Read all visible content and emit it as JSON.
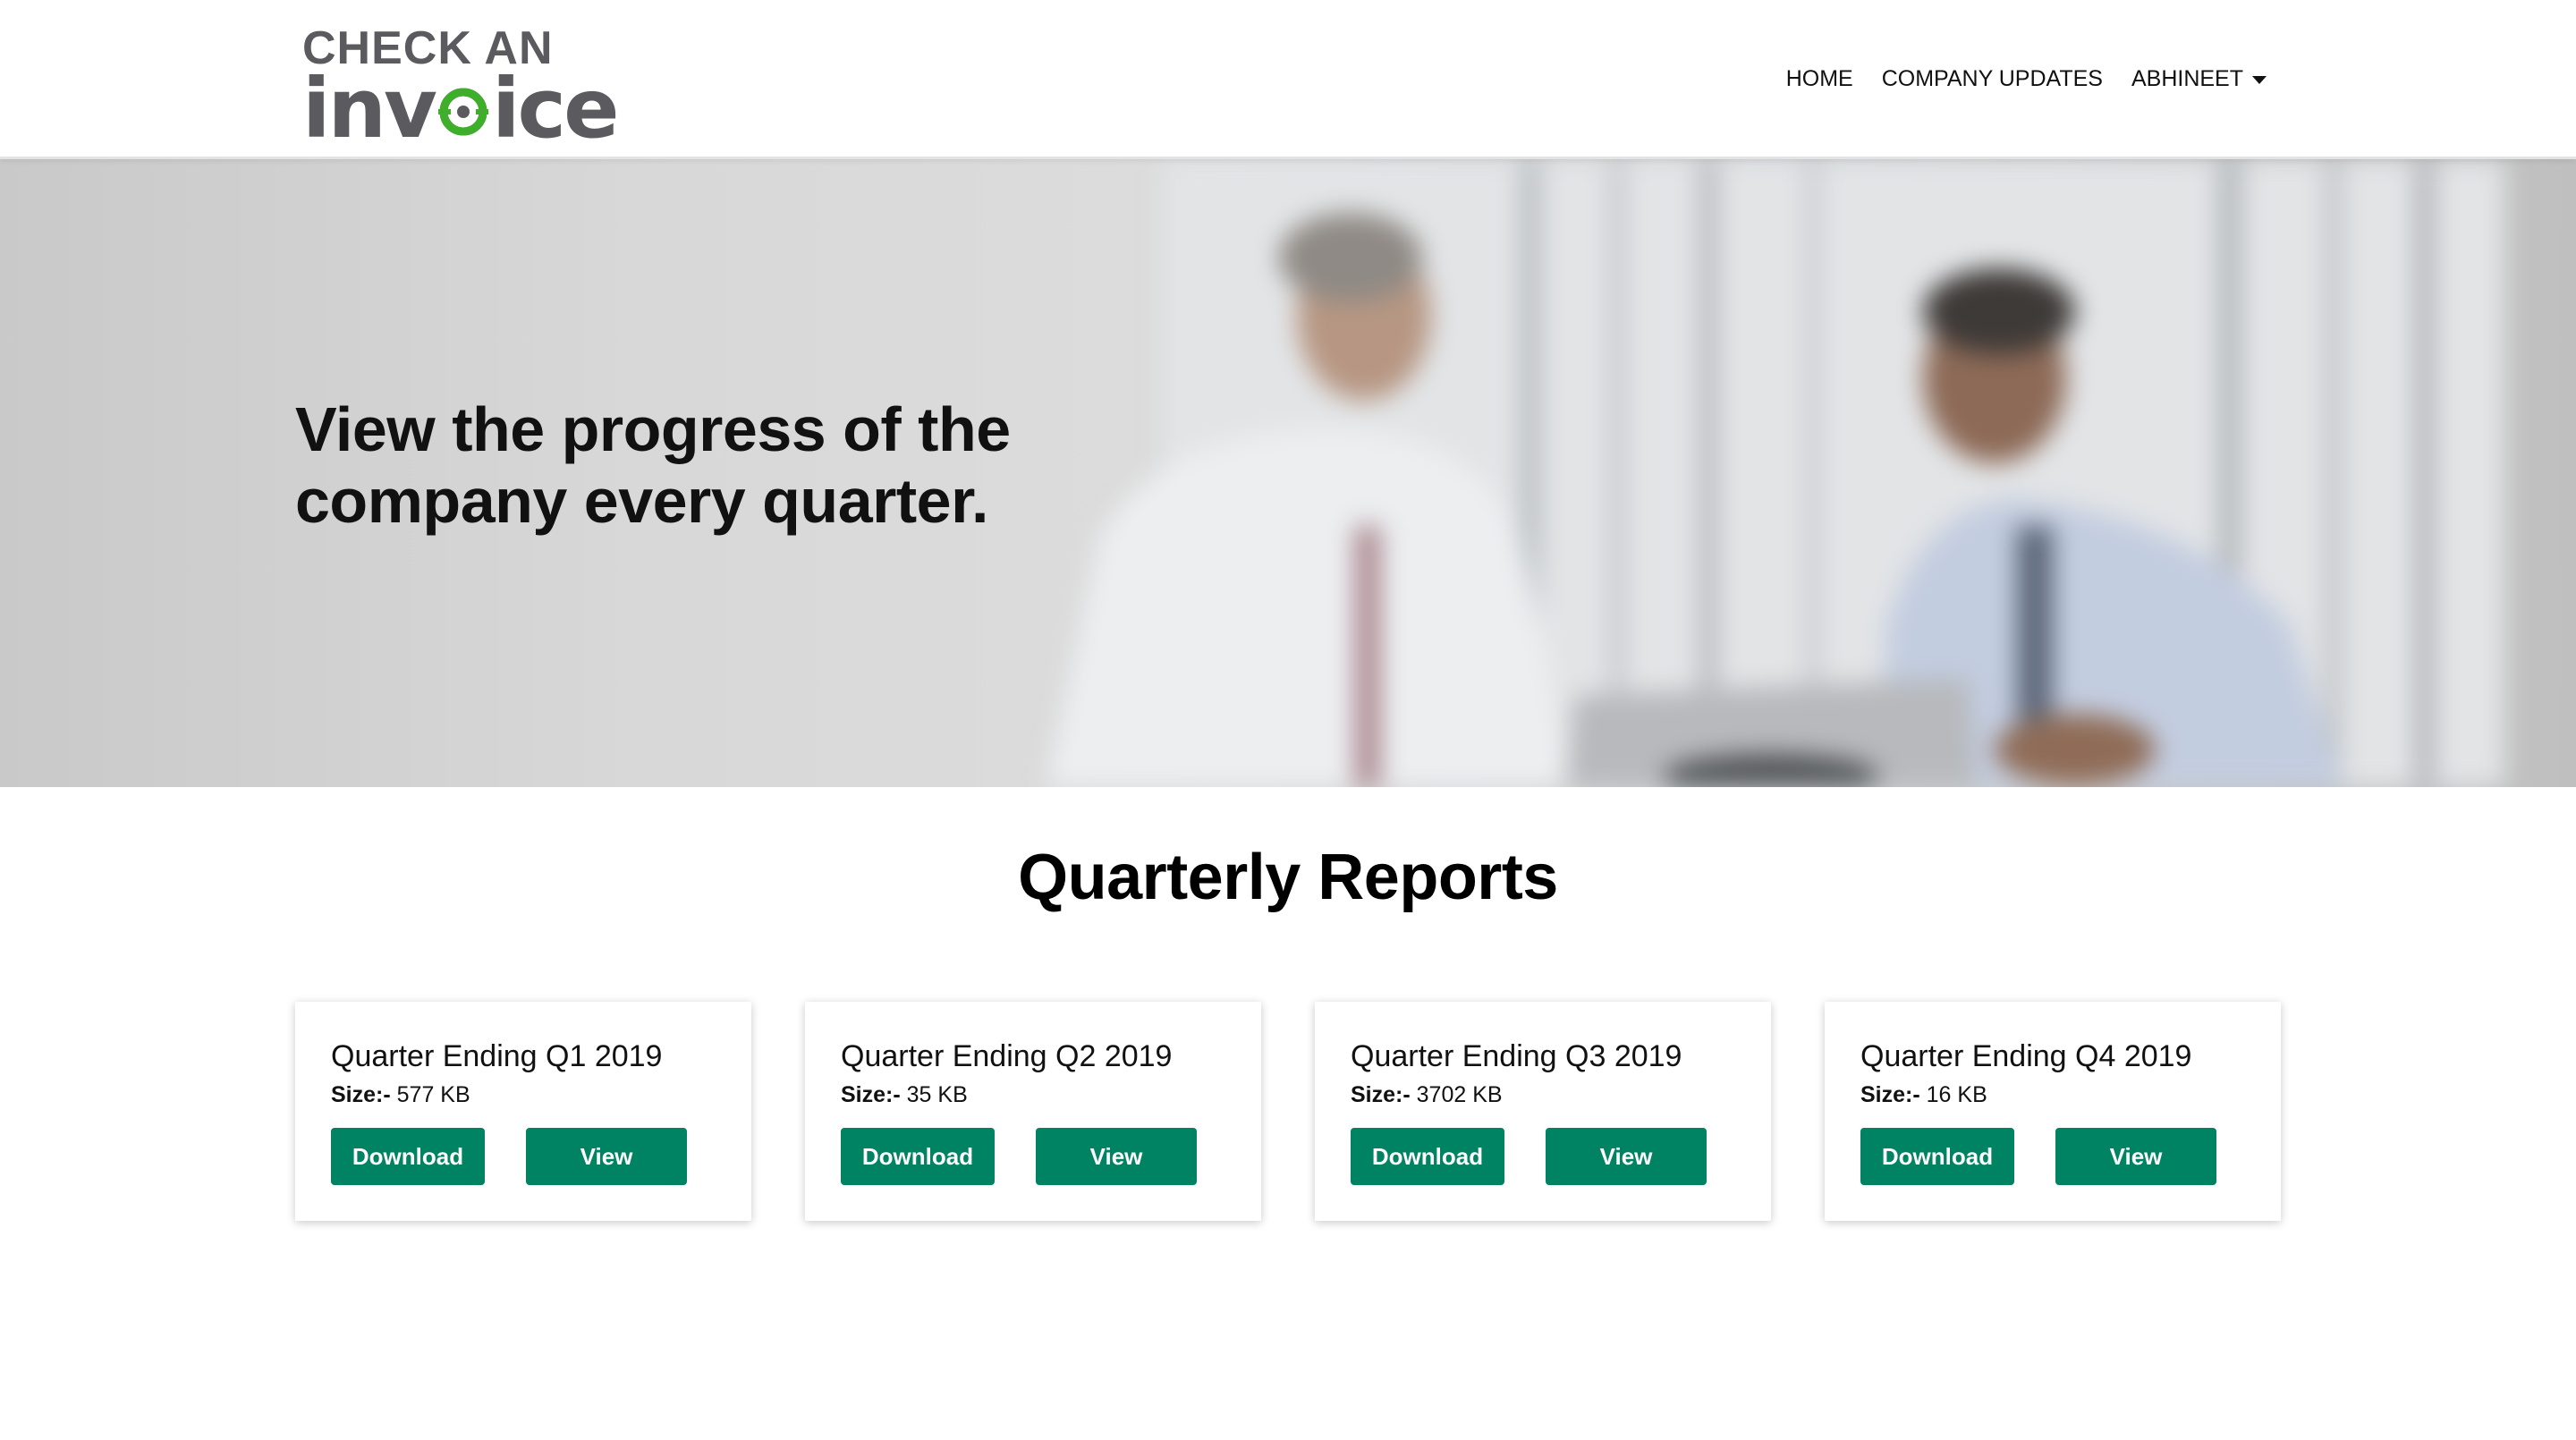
{
  "header": {
    "logo": {
      "line1": "CHECK AN",
      "line2_prefix": "inv",
      "line2_suffix": "ice",
      "o_icon": "target-o-icon",
      "accent_color": "#3fae2a",
      "text_color": "#5b5b5f"
    },
    "nav": {
      "home": "HOME",
      "company_updates": "COMPANY UPDATES",
      "user": "ABHINEET",
      "user_dropdown_icon": "caret-down-icon"
    }
  },
  "hero": {
    "headline": "View the progress of the company every quarter.",
    "image": "blurred-business-meeting-photo"
  },
  "main": {
    "section_title": "Quarterly Reports",
    "size_label": "Size:-",
    "reports": [
      {
        "title": "Quarter Ending Q1 2019",
        "size": "577 KB",
        "download_label": "Download",
        "view_label": "View"
      },
      {
        "title": "Quarter Ending Q2 2019",
        "size": "35 KB",
        "download_label": "Download",
        "view_label": "View"
      },
      {
        "title": "Quarter Ending Q3 2019",
        "size": "3702 KB",
        "download_label": "Download",
        "view_label": "View"
      },
      {
        "title": "Quarter Ending Q4 2019",
        "size": "16 KB",
        "download_label": "Download",
        "view_label": "View"
      }
    ]
  },
  "colors": {
    "button_green": "#008362",
    "button_text": "#ffffff",
    "heading_text": "#111111"
  }
}
